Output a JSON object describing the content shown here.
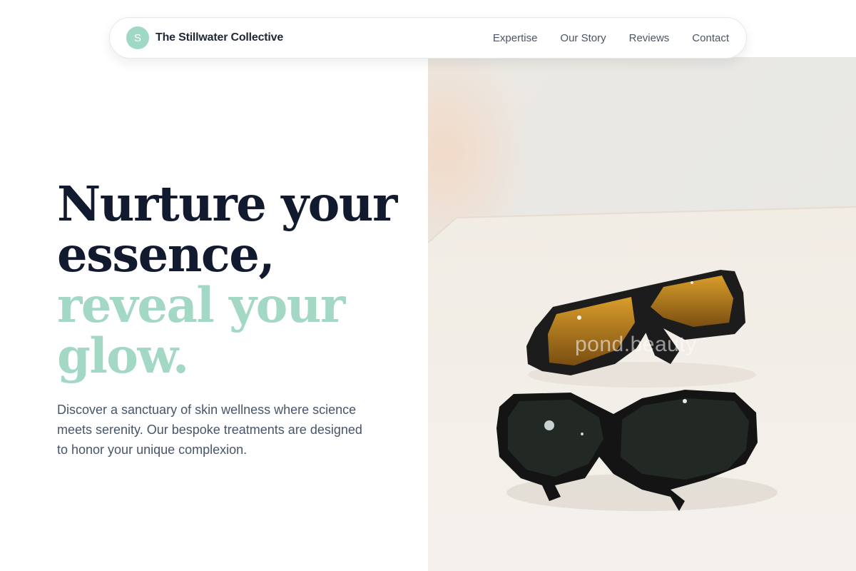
{
  "brand": {
    "logo_letter": "S",
    "name": "The Stillwater Collective",
    "accent_color": "#9fd8c4"
  },
  "nav": {
    "links": [
      "Expertise",
      "Our Story",
      "Reviews",
      "Contact"
    ]
  },
  "hero": {
    "headline_line1": "Nurture your",
    "headline_line2": "essence,",
    "headline_accent_line1": "reveal your",
    "headline_accent_line2": "glow.",
    "description": "Discover a sanctuary of skin wellness where science meets serenity. Our bespoke treatments are designed to honor your unique complexion.",
    "image_watermark": "pond.beauty"
  },
  "colors": {
    "heading": "#111a2e",
    "accent": "#a3d8c5",
    "body_text": "#475569"
  }
}
